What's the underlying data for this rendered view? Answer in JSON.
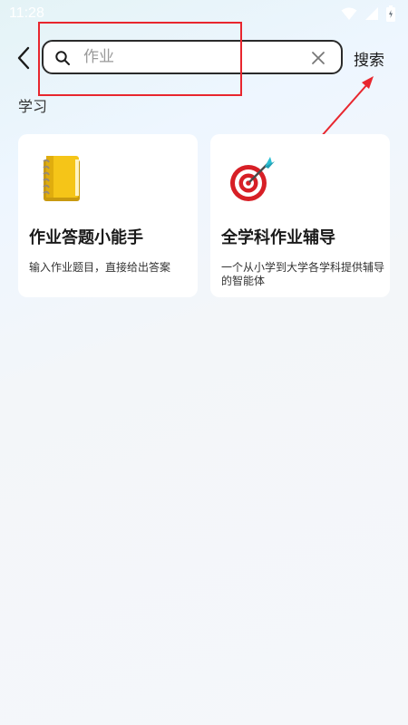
{
  "status": {
    "time": "11:28"
  },
  "search": {
    "placeholder": "作业",
    "value": "",
    "action_label": "搜索"
  },
  "section": {
    "title": "学习"
  },
  "cards": [
    {
      "title": "作业答题小能手",
      "description": "输入作业题目，直接给出答案",
      "icon": "notebook-icon"
    },
    {
      "title": "全学科作业辅导",
      "description": "一个从小学到大学各学科提供辅导的智能体",
      "icon": "dart-target-icon"
    }
  ],
  "colors": {
    "annotation": "#e8262e",
    "background": "#f5f7fa",
    "card": "#ffffff"
  }
}
